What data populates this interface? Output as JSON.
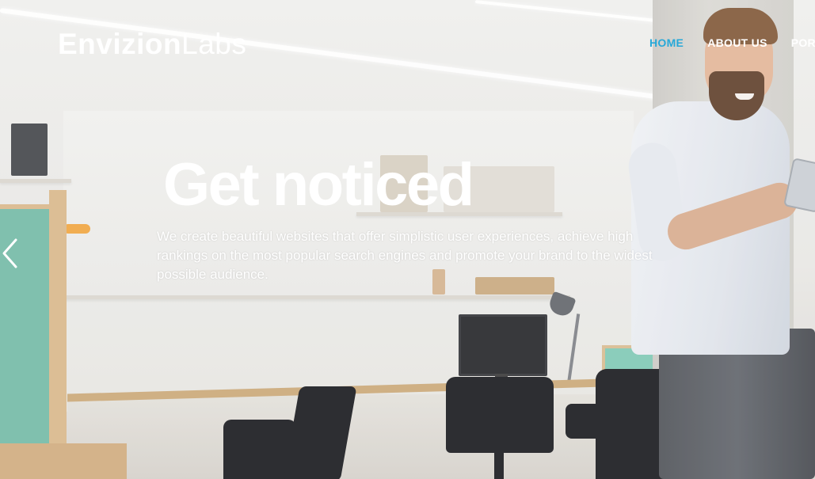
{
  "header": {
    "logo_primary": "Envizion",
    "logo_secondary": "Labs",
    "nav": [
      {
        "label": "HOME",
        "active": true
      },
      {
        "label": "ABOUT US",
        "active": false
      },
      {
        "label": "PORT",
        "active": false
      }
    ]
  },
  "hero": {
    "headline": "Get noticed",
    "description": "We create beautiful websites that offer simplistic user experiences, achieve high rankings on the most popular search engines and promote your brand to the widest possible audience.",
    "prev_icon": "chevron-left-icon"
  },
  "colors": {
    "accent": "#27a8d8",
    "text": "#ffffff"
  }
}
